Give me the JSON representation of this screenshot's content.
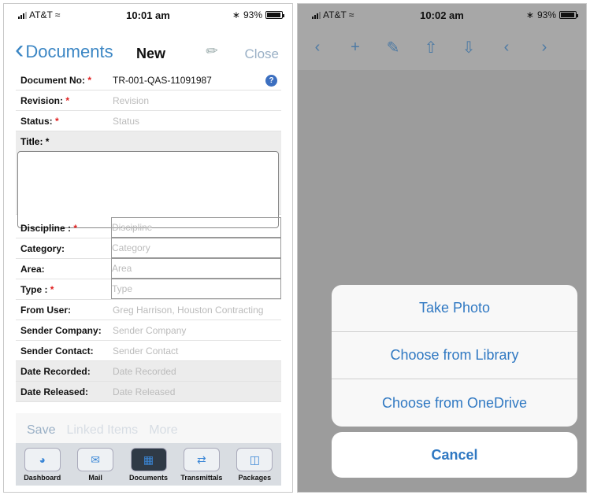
{
  "left": {
    "status": {
      "carrier": "AT&T",
      "time": "10:01 am",
      "battery": "93%"
    },
    "nav": {
      "back_label": "Documents",
      "title": "New",
      "close_label": "Close"
    },
    "form": {
      "document_no": {
        "label": "Document No:",
        "value": "TR-001-QAS-11091987"
      },
      "revision": {
        "label": "Revision:",
        "placeholder": "Revision"
      },
      "status": {
        "label": "Status:",
        "placeholder": "Status"
      },
      "title": {
        "label": "Title:"
      },
      "discipline": {
        "label": "Discipline :",
        "placeholder": "Discipline"
      },
      "category": {
        "label": "Category:",
        "placeholder": "Category"
      },
      "area": {
        "label": "Area:",
        "placeholder": "Area"
      },
      "type": {
        "label": "Type :",
        "placeholder": "Type"
      },
      "from_user": {
        "label": "From User:",
        "value": "Greg Harrison, Houston Contracting"
      },
      "sender_company": {
        "label": "Sender Company:",
        "placeholder": "Sender Company"
      },
      "sender_contact": {
        "label": "Sender Contact:",
        "placeholder": "Sender Contact"
      },
      "date_recorded": {
        "label": "Date Recorded:",
        "placeholder": "Date Recorded"
      },
      "date_released": {
        "label": "Date Released:",
        "placeholder": "Date Released"
      }
    },
    "actions": {
      "save": "Save",
      "linked": "Linked Items",
      "more": "More"
    },
    "tabs": [
      "Dashboard",
      "Mail",
      "Documents",
      "Transmittals",
      "Packages"
    ]
  },
  "right": {
    "status": {
      "carrier": "AT&T",
      "time": "10:02 am",
      "battery": "93%"
    },
    "sheet": {
      "take_photo": "Take Photo",
      "library": "Choose from Library",
      "onedrive": "Choose from OneDrive",
      "cancel": "Cancel"
    }
  },
  "required_mark": "*",
  "help_glyph": "?",
  "colors": {
    "accent": "#2f78c2",
    "nav_blue": "#3b86c4",
    "required": "#e02020"
  }
}
